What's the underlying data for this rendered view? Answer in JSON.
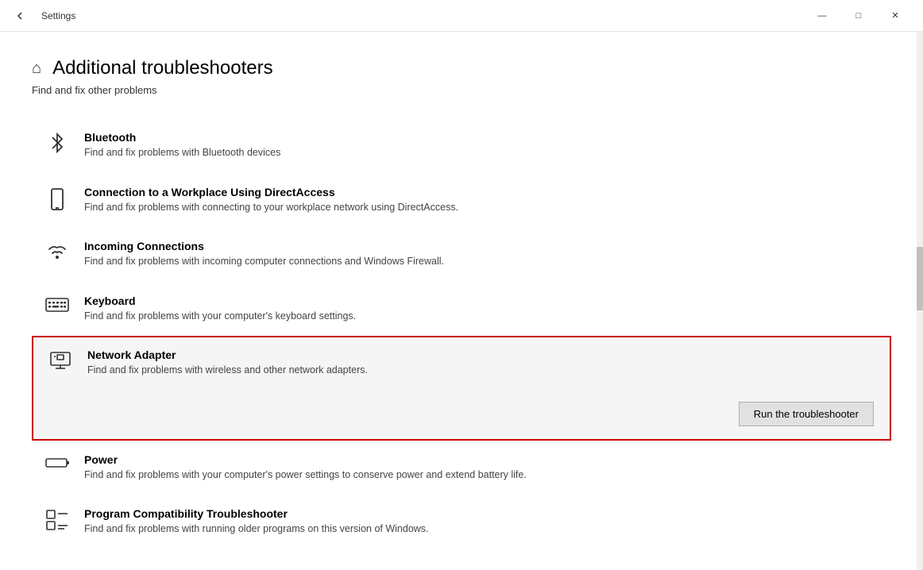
{
  "titlebar": {
    "title": "Settings",
    "back_label": "←",
    "minimize_label": "—",
    "maximize_label": "□",
    "close_label": "✕"
  },
  "page": {
    "home_icon": "⌂",
    "title": "Additional troubleshooters",
    "subtitle": "Find and fix other problems"
  },
  "items": [
    {
      "id": "bluetooth",
      "name": "Bluetooth",
      "description": "Find and fix problems with Bluetooth devices",
      "icon": "bluetooth",
      "expanded": false
    },
    {
      "id": "directaccess",
      "name": "Connection to a Workplace Using DirectAccess",
      "description": "Find and fix problems with connecting to your workplace\nnetwork using DirectAccess.",
      "icon": "phone",
      "expanded": false
    },
    {
      "id": "incoming",
      "name": "Incoming Connections",
      "description": "Find and fix problems with incoming computer connections and\nWindows Firewall.",
      "icon": "signal",
      "expanded": false
    },
    {
      "id": "keyboard",
      "name": "Keyboard",
      "description": "Find and fix problems with your computer's keyboard settings.",
      "icon": "keyboard",
      "expanded": false
    },
    {
      "id": "network-adapter",
      "name": "Network Adapter",
      "description": "Find and fix problems with wireless and other network adapters.",
      "icon": "monitor",
      "expanded": true,
      "run_label": "Run the troubleshooter"
    },
    {
      "id": "power",
      "name": "Power",
      "description": "Find and fix problems with your computer's power settings to\nconserve power and extend battery life.",
      "icon": "battery",
      "expanded": false
    },
    {
      "id": "program-compatibility",
      "name": "Program Compatibility Troubleshooter",
      "description": "Find and fix problems with running older programs on this\nversion of Windows.",
      "icon": "list",
      "expanded": false
    }
  ]
}
